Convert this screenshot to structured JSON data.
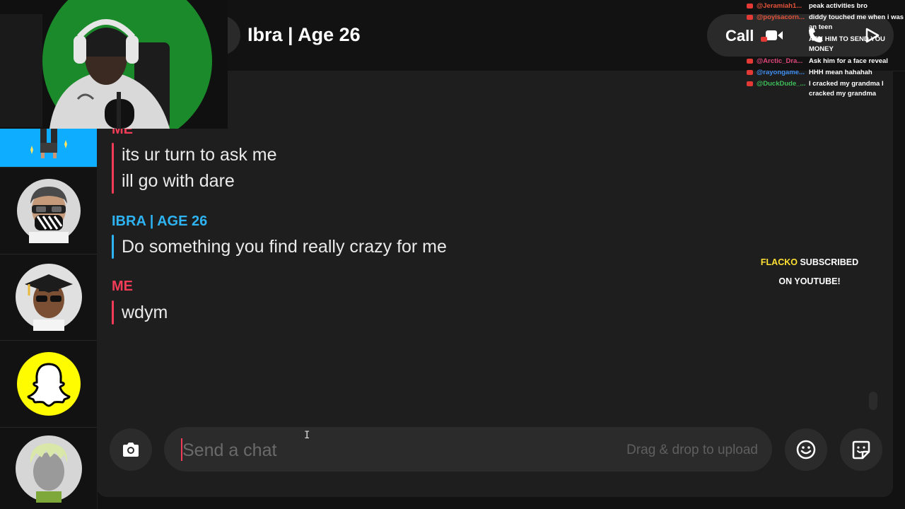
{
  "header": {
    "chat_name": "Ibra | Age 26",
    "call_label": "Call"
  },
  "messages": [
    {
      "sender": "ME",
      "lines": [
        "its ur turn to ask me",
        "ill go with dare"
      ]
    },
    {
      "sender": "IBRA | AGE 26",
      "lines": [
        "Do something you find really crazy for me"
      ]
    },
    {
      "sender": "ME",
      "lines": [
        "wdym"
      ]
    }
  ],
  "composer": {
    "placeholder": "Send a chat",
    "drag_hint": "Drag & drop to upload"
  },
  "stream_chat": [
    {
      "user": "@Jeramiah1...",
      "color": "#e5533a",
      "text": "peak activities bro"
    },
    {
      "user": "@poyisacorn...",
      "color": "#e5533a",
      "text": "diddy touched me when i was an teen"
    },
    {
      "user": "",
      "color": "#e5533a",
      "text": "ASK HIM TO SEND YOU MONEY"
    },
    {
      "user": "@Arctic_Dra...",
      "color": "#e0477a",
      "text": "Ask him for a face reveal"
    },
    {
      "user": "@rayongame...",
      "color": "#3f8ef0",
      "text": "HHH mean hahahah"
    },
    {
      "user": "@DuckDude_...",
      "color": "#3fbf5a",
      "text": "I cracked my grandma I cracked my grandma"
    }
  ],
  "sub_alert": {
    "name": "FLACKO",
    "text": "SUBSCRIBED ON YOUTUBE!"
  },
  "colors": {
    "me": "#f23c57",
    "them": "#2eb3f3",
    "snap_yellow": "#fffc00",
    "active_blue": "#0eadff"
  }
}
